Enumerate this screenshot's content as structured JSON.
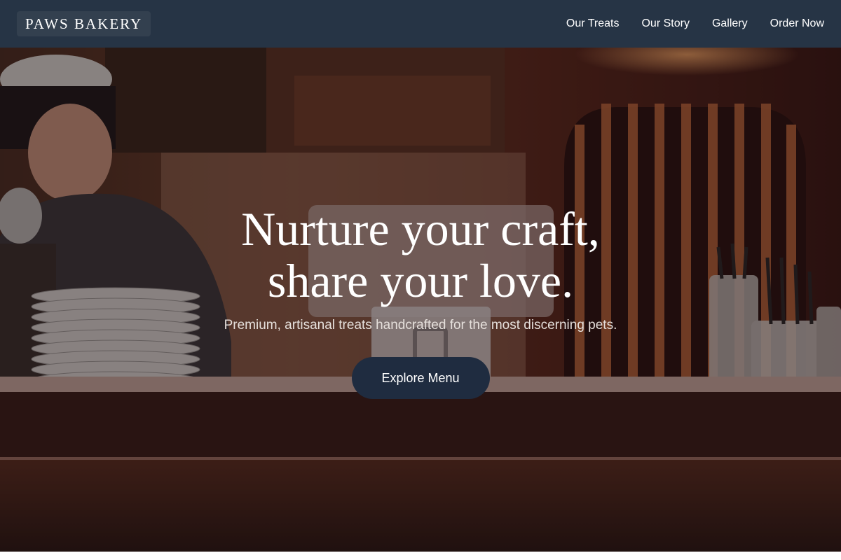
{
  "header": {
    "logo": "PAWS BAKERY",
    "nav": [
      {
        "label": "Our Treats"
      },
      {
        "label": "Our Story"
      },
      {
        "label": "Gallery"
      },
      {
        "label": "Order Now"
      }
    ]
  },
  "hero": {
    "headline_line1": "Nurture your craft,",
    "headline_line2": "share your love.",
    "subtitle": "Premium, artisanal treats handcrafted for the most discerning pets.",
    "cta_label": "Explore Menu",
    "image_alt": "Baker working behind a bakery counter with stacked plates and glass utensil holders"
  },
  "colors": {
    "header_bg": "#263445",
    "cta_bg": "#1f2c40",
    "text_light": "#ffffff"
  }
}
